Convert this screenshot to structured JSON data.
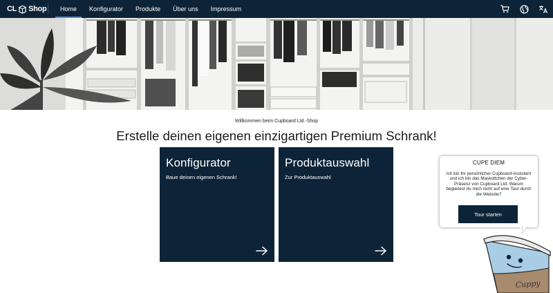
{
  "nav": {
    "logo_left": "CL",
    "logo_right": "Shop",
    "links": [
      {
        "label": "Home",
        "active": true
      },
      {
        "label": "Konfigurator",
        "active": false
      },
      {
        "label": "Produkte",
        "active": false
      },
      {
        "label": "Über uns",
        "active": false
      },
      {
        "label": "Impressum",
        "active": false
      }
    ],
    "icons": [
      "cart-icon",
      "globe-icon",
      "translate-icon"
    ]
  },
  "main": {
    "welcome": "Willkommen beim Cupboard Ltd.-Shop",
    "headline": "Erstelle deinen eigenen einzigartigen Premium Schrank!"
  },
  "cards": [
    {
      "title": "Konfigurator",
      "subtitle": "Baue deinen eigenen Schrank!"
    },
    {
      "title": "Produktauswahl",
      "subtitle": "Zur Produktauswahl"
    }
  ],
  "mascot": {
    "title": "CUPE DIEM",
    "text": "Ich bin Ihr persönlicher Cupboard-Assistent und ich bin das Maskottchen der Cyber-Präsenz von Cupboard Ltd. Warum begleitest du mich nicht auf eine Tour durch die Website?",
    "button": "Tour starten",
    "cup_label": "Cuppy"
  },
  "colors": {
    "navy": "#0d2438",
    "accent": "#4d8fe0",
    "cup_blue": "#a9cde4",
    "cup_brown": "#a88a6c"
  }
}
